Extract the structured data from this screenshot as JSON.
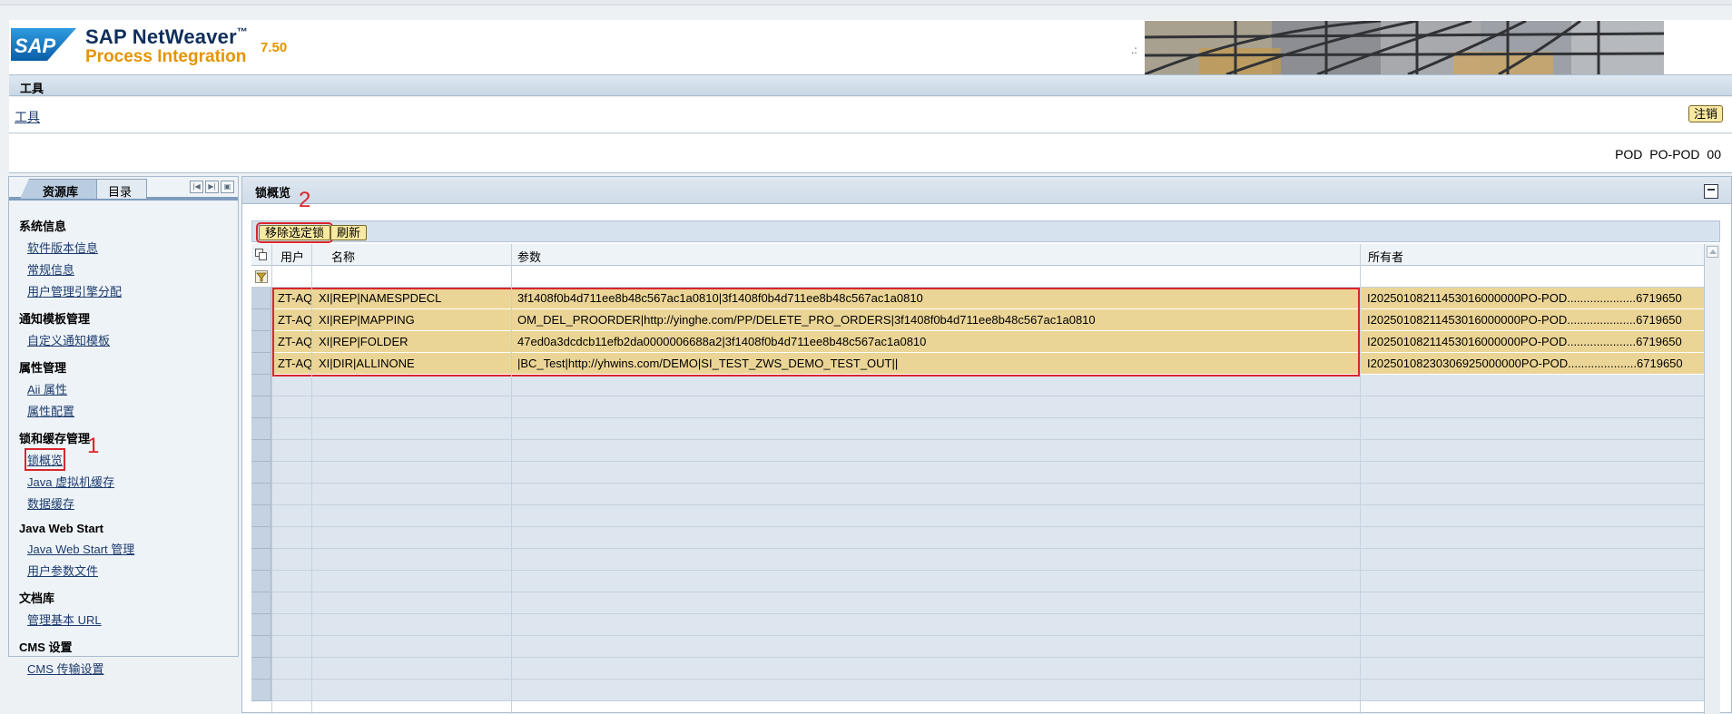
{
  "header": {
    "brand_line1": "SAP NetWeaver",
    "brand_tm": "™",
    "brand_line2": "Process Integration",
    "version": "7.50",
    "dots": ".:"
  },
  "toolbar": {
    "title": "工具",
    "tool_link": "工具",
    "logout": "注销",
    "user_info": "POD  PO-POD  00"
  },
  "left_tabs": {
    "repo": "资源库",
    "directory": "目录"
  },
  "nav": {
    "system_info": "系统信息",
    "software_version": "软件版本信息",
    "general_info": "常规信息",
    "user_mgmt": "用户管理引擎分配",
    "notify_template_mgmt": "通知模板管理",
    "custom_notify_template": "自定义通知模板",
    "property_mgmt": "属性管理",
    "aii_property": "Aii 属性",
    "property_config": "属性配置",
    "lock_cache_mgmt": "锁和缓存管理",
    "lock_overview": "锁概览",
    "java_vm_cache": "Java 虚拟机缓存",
    "data_cache": "数据缓存",
    "java_web_start": "Java Web Start",
    "java_web_start_mgmt": "Java Web Start 管理",
    "user_param_file": "用户参数文件",
    "doc_repo": "文档库",
    "manage_base_url": "管理基本 URL",
    "cms_settings": "CMS 设置",
    "cms_transport": "CMS 传输设置"
  },
  "annotations": {
    "a1": "1",
    "a2": "2"
  },
  "main": {
    "title": "锁概览",
    "btn_remove": "移除选定锁",
    "btn_refresh": "刷新",
    "columns": {
      "user": "用户",
      "name": "名称",
      "param": "参数",
      "owner": "所有者"
    },
    "rows": [
      {
        "user": "ZT-AQ",
        "name": "XI|REP|NAMESPDECL",
        "param": "3f1408f0b4d711ee8b48c567ac1a0810|3f1408f0b4d711ee8b48c567ac1a0810",
        "owner": "I20250108211453016000000PO-POD.....................6719650"
      },
      {
        "user": "ZT-AQ",
        "name": "XI|REP|MAPPING",
        "param": "OM_DEL_PROORDER|http://yinghe.com/PP/DELETE_PRO_ORDERS|3f1408f0b4d711ee8b48c567ac1a0810",
        "owner": "I20250108211453016000000PO-POD.....................6719650"
      },
      {
        "user": "ZT-AQ",
        "name": "XI|REP|FOLDER",
        "param": "47ed0a3dcdcb11efb2da0000006688a2|3f1408f0b4d711ee8b48c567ac1a0810",
        "owner": "I20250108211453016000000PO-POD.....................6719650"
      },
      {
        "user": "ZT-AQ",
        "name": "XI|DIR|ALLINONE",
        "param": "|BC_Test|http://yhwins.com/DEMO|SI_TEST_ZWS_DEMO_TEST_OUT||",
        "owner": "I20250108230306925000000PO-POD.....................6719650"
      }
    ]
  },
  "colors": {
    "row_highlight": "#ebd596",
    "button_bg": "#f9e9a2",
    "annotation_red": "#d9262c",
    "brand_orange": "#e59400",
    "brand_navy": "#0f2f5c"
  }
}
